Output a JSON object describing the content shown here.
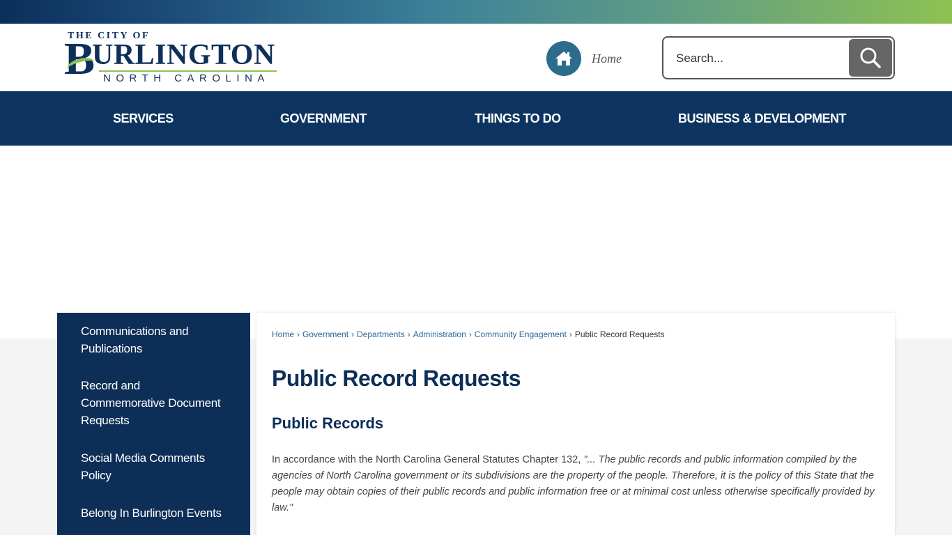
{
  "header": {
    "logo": {
      "top_text": "THE CITY OF",
      "main_text": "URLINGTON",
      "initial": "B",
      "sub_text": "NORTH CAROLINA"
    },
    "home_label": "Home",
    "search": {
      "placeholder": "Search..."
    }
  },
  "nav": {
    "items": [
      {
        "label": "SERVICES"
      },
      {
        "label": "GOVERNMENT"
      },
      {
        "label": "THINGS TO DO"
      },
      {
        "label": "BUSINESS & DEVELOPMENT"
      }
    ]
  },
  "sidebar": {
    "items": [
      {
        "label": "Communications and Publications"
      },
      {
        "label": "Record and Commemorative Document Requests"
      },
      {
        "label": "Social Media Comments Policy"
      },
      {
        "label": "Belong In Burlington Events"
      }
    ]
  },
  "breadcrumb": {
    "items": [
      "Home",
      "Government",
      "Departments",
      "Administration",
      "Community Engagement"
    ],
    "current": "Public Record Requests",
    "separator": "›"
  },
  "main": {
    "title": "Public Record Requests",
    "subtitle": "Public Records",
    "paragraph_lead": "In accordance with the North Carolina General Statutes Chapter 132, ",
    "paragraph_quote": "\"... The public records and public information compiled by the agencies of North Carolina government or its subdivisions are the property of the people. Therefore, it is the policy of this State that the people may obtain copies of their public records and public information free or at minimal cost unless otherwise specifically provided by law.\""
  },
  "colors": {
    "navy": "#0d3461",
    "sidebar_navy": "#0d2e57",
    "accent_green": "#8ec152",
    "home_circle": "#2e6c8e",
    "link_blue": "#2a6496"
  },
  "icons": {
    "home": "home-icon",
    "search": "search-icon"
  }
}
